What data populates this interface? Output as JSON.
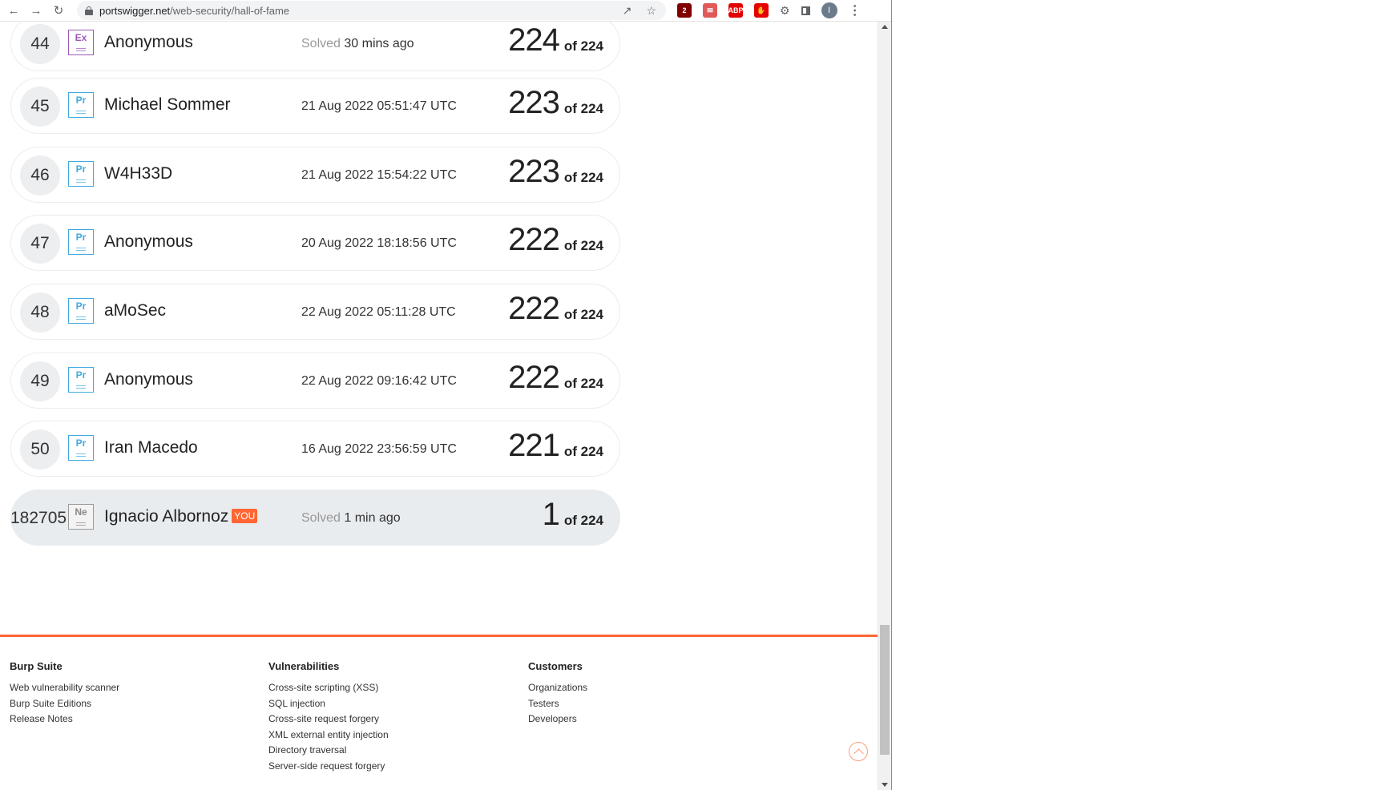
{
  "browser": {
    "url_host": "portswigger.net",
    "url_path": "/web-security/hall-of-fame",
    "extensions": [
      {
        "name": "ublock",
        "label": "2",
        "color": "#800000"
      },
      {
        "name": "mail-ext",
        "label": "✉",
        "color": "#e05a5a"
      },
      {
        "name": "abp",
        "label": "ABP",
        "color": "#e40000"
      },
      {
        "name": "stop",
        "label": "✋",
        "color": "#e40000"
      }
    ],
    "profile_initial": "I"
  },
  "leaderboard": {
    "of_label": "of 224",
    "rows": [
      {
        "rank": "44",
        "badge": "Ex",
        "name": "Anonymous",
        "solved_prefix": "Solved",
        "solved": "30 mins ago",
        "score": "224"
      },
      {
        "rank": "45",
        "badge": "Pr",
        "name": "Michael Sommer",
        "solved_prefix": "",
        "solved": "21 Aug 2022 05:51:47 UTC",
        "score": "223"
      },
      {
        "rank": "46",
        "badge": "Pr",
        "name": "W4H33D",
        "solved_prefix": "",
        "solved": "21 Aug 2022 15:54:22 UTC",
        "score": "223"
      },
      {
        "rank": "47",
        "badge": "Pr",
        "name": "Anonymous",
        "solved_prefix": "",
        "solved": "20 Aug 2022 18:18:56 UTC",
        "score": "222"
      },
      {
        "rank": "48",
        "badge": "Pr",
        "name": "aMoSec",
        "solved_prefix": "",
        "solved": "22 Aug 2022 05:11:28 UTC",
        "score": "222"
      },
      {
        "rank": "49",
        "badge": "Pr",
        "name": "Anonymous",
        "solved_prefix": "",
        "solved": "22 Aug 2022 09:16:42 UTC",
        "score": "222"
      },
      {
        "rank": "50",
        "badge": "Pr",
        "name": "Iran Macedo",
        "solved_prefix": "",
        "solved": "16 Aug 2022 23:56:59 UTC",
        "score": "221"
      }
    ],
    "you": {
      "rank": "182705",
      "badge": "Ne",
      "name": "Ignacio Albornoz",
      "tag": "YOU",
      "solved_prefix": "Solved",
      "solved": "1 min ago",
      "score": "1"
    }
  },
  "footer": {
    "columns": [
      {
        "title": "Burp Suite",
        "links": [
          "Web vulnerability scanner",
          "Burp Suite Editions",
          "Release Notes"
        ]
      },
      {
        "title": "Vulnerabilities",
        "links": [
          "Cross-site scripting (XSS)",
          "SQL injection",
          "Cross-site request forgery",
          "XML external entity injection",
          "Directory traversal",
          "Server-side request forgery"
        ]
      },
      {
        "title": "Customers",
        "links": [
          "Organizations",
          "Testers",
          "Developers"
        ]
      }
    ]
  }
}
